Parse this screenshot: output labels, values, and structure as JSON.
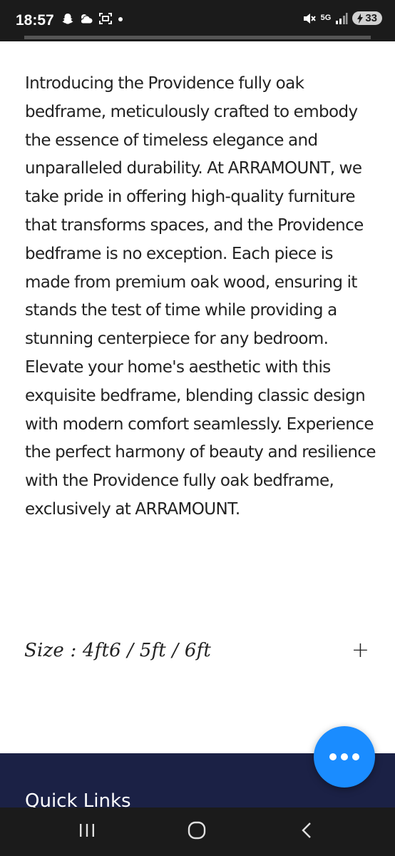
{
  "status_bar": {
    "time": "18:57",
    "left_icons": [
      "snapchat-icon",
      "weather-icon",
      "screenshot-icon",
      "dot-icon"
    ],
    "network": "5G",
    "battery_level": "33"
  },
  "product": {
    "description": "Introducing the Providence fully oak bedframe, meticulously crafted to embody the essence of timeless elegance and unparalleled durability. At ARRAMOUNT, we take pride in offering high-quality furniture that transforms spaces, and the Providence bedframe is no exception. Each piece is made from premium oak wood, ensuring it stands the test of time while providing a stunning centerpiece for any bedroom. Elevate your home's aesthetic with this exquisite bedframe, blending classic design with modern comfort seamlessly. Experience the perfect harmony of beauty and resilience with the Providence fully oak bedframe, exclusively at ARRAMOUNT.",
    "size_label": "Size : 4ft6 / 5ft / 6ft",
    "expand_symbol": "+"
  },
  "footer": {
    "heading": "Quick Links"
  },
  "colors": {
    "footer_bg": "#1b2145",
    "fab_bg": "#1a8cff",
    "system_bar_bg": "#1b1b1b"
  },
  "nav_bar": {
    "buttons": [
      "recents-icon",
      "home-icon",
      "back-icon"
    ]
  }
}
